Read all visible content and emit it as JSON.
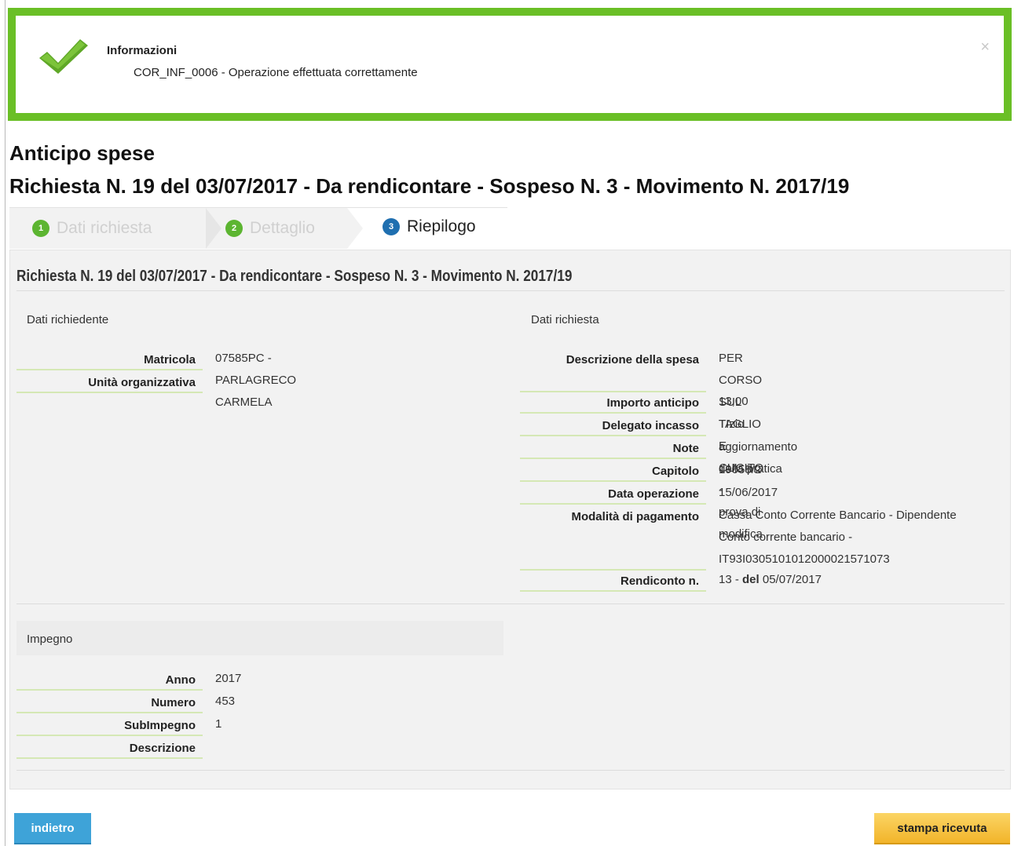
{
  "alert": {
    "title": "Informazioni",
    "message": "COR_INF_0006 - Operazione effettuata correttamente",
    "close_label": "×",
    "icon": "checkmark-icon",
    "color": "#6abf26"
  },
  "page": {
    "title": "Anticipo spese",
    "subtitle": "Richiesta N. 19 del 03/07/2017 - Da rendicontare - Sospeso N. 3 - Movimento N. 2017/19"
  },
  "wizard": {
    "steps": [
      {
        "number": "1",
        "label": "Dati richiesta",
        "state": "done"
      },
      {
        "number": "2",
        "label": "Dettaglio",
        "state": "done"
      },
      {
        "number": "3",
        "label": "Riepilogo",
        "state": "active"
      }
    ]
  },
  "summary": {
    "title": "Richiesta N. 19 del 03/07/2017 - Da rendicontare - Sospeso N. 3 - Movimento N. 2017/19",
    "richiedente": {
      "heading": "Dati richiedente",
      "fields": [
        {
          "label": "Matricola",
          "value": "07585PC - PARLAGRECO CARMELA"
        },
        {
          "label": "Unità organizzativa",
          "value": ""
        }
      ]
    },
    "richiesta": {
      "heading": "Dati richiesta",
      "fields": [
        {
          "label": "Descrizione della spesa",
          "value_line1": "PER CORSO SUL TAGLIO E CUCITO -",
          "value_line2": "prova di modifica"
        },
        {
          "label": "Importo anticipo",
          "value": "13,00"
        },
        {
          "label": "Delegato incasso",
          "value": "TIzio"
        },
        {
          "label": "Note",
          "value": "aggiornamento della pratica"
        },
        {
          "label": "Capitolo",
          "value": "19058/2"
        },
        {
          "label": "Data operazione",
          "value": "15/06/2017"
        },
        {
          "label": "Modalità di pagamento",
          "value_line1": "Cassa Conto Corrente Bancario - Dipendente",
          "value_line2": "Conto corrente bancario -",
          "value_line3": "IT93I0305101012000021571073"
        },
        {
          "label": "Rendiconto n.",
          "value_num": "13 - ",
          "value_del": "del",
          "value_date": " 05/07/2017"
        }
      ]
    },
    "impegno": {
      "heading": "Impegno",
      "fields": [
        {
          "label": "Anno",
          "value": "2017"
        },
        {
          "label": "Numero",
          "value": "453"
        },
        {
          "label": "SubImpegno",
          "value": "1"
        },
        {
          "label": "Descrizione",
          "value": ""
        }
      ]
    }
  },
  "actions": {
    "back_label": "indietro",
    "print_label": "stampa ricevuta"
  }
}
